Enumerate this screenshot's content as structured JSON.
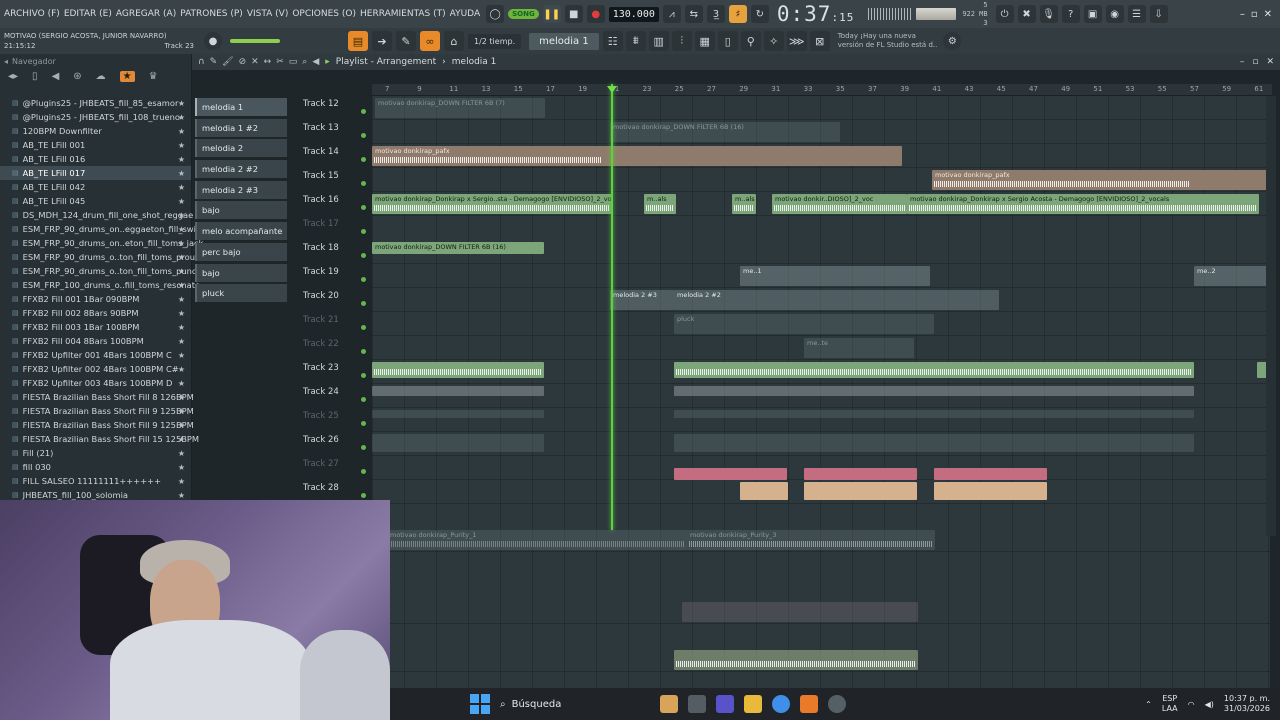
{
  "menu": [
    "ARCHIVO (F)",
    "EDITAR (E)",
    "AGREGAR (A)",
    "PATRONES (P)",
    "VISTA (V)",
    "OPCIONES (O)",
    "HERRAMIENTAS (T)",
    "AYUDA"
  ],
  "transport": {
    "song_label": "SONG",
    "tempo": "130.000",
    "time": "0:37",
    "time_sub": ":15",
    "time_mode": "M:S:CS",
    "cpu": "5",
    "mem": "922 MB",
    "voices": "3"
  },
  "project": {
    "title": "MOTIVAO (SERGIO ACOSTA, JUNIOR NAVARRO)",
    "clock": "21:15:12",
    "track": "Track 23"
  },
  "toolbar2": {
    "snap": "1/2 tiemp.",
    "pattern": "melodia 1",
    "news_line1": "Today  ¡Hay una nueva",
    "news_line2": "versión de FL Studio está d.."
  },
  "browser": {
    "title": "Navegador",
    "items": [
      "@Plugins25 - JHBEATS_fill_85_esamor",
      "@Plugins25 - JHBEATS_fill_108_trueno",
      "120BPM Downfilter",
      "AB_TE LFill 001",
      "AB_TE LFill 016",
      "AB_TE LFill 017",
      "AB_TE LFill 042",
      "AB_TE LFill 045",
      "DS_MDH_124_drum_fill_one_shot_reggae",
      "ESM_FRP_90_drums_on..eggaeton_fill_swing",
      "ESM_FRP_90_drums_on..eton_fill_toms_jack",
      "ESM_FRP_90_drums_o..ton_fill_toms_proud",
      "ESM_FRP_90_drums_o..ton_fill_toms_punch",
      "ESM_FRP_100_drums_o..fill_toms_resonate",
      "FFXB2 Fill 001 1Bar 090BPM",
      "FFXB2 Fill 002 8Bars 90BPM",
      "FFXB2 Fill 003 1Bar 100BPM",
      "FFXB2 Fill 004 8Bars 100BPM",
      "FFXB2 Upfilter 001 4Bars 100BPM C",
      "FFXB2 Upfilter 002 4Bars 100BPM C#",
      "FFXB2 Upfilter 003 4Bars 100BPM D",
      "FIESTA Brazilian Bass Short Fill 8 126BPM",
      "FIESTA Brazilian Bass Short Fill 9 125BPM",
      "FIESTA Brazilian Bass Short Fill 9 125BPM",
      "FIESTA Brazilian Bass Short Fill 15 125BPM",
      "Fill  (21)",
      "fill 030",
      "FILL SALSEO 11111111++++++",
      "JHBEATS_fill_100_solomia"
    ]
  },
  "picker": [
    "melodia 1",
    "melodia 1 #2",
    "melodia 2",
    "melodia 2 #2",
    "melodia 2 #3",
    "bajo",
    "melo acompañante",
    "perc bajo",
    "bajo",
    "pluck"
  ],
  "playlist": {
    "title": "Playlist - Arrangement",
    "crumb": "melodia 1",
    "ruler": [
      "7",
      "9",
      "11",
      "13",
      "15",
      "17",
      "19",
      "21",
      "23",
      "25",
      "27",
      "29",
      "31",
      "33",
      "35",
      "37",
      "39",
      "41",
      "43",
      "45",
      "47",
      "49",
      "51",
      "53",
      "55",
      "57",
      "59",
      "61"
    ],
    "tracks": [
      "Track 12",
      "Track 13",
      "Track 14",
      "Track 15",
      "Track 16",
      "Track 17",
      "Track 18",
      "Track 19",
      "Track 20",
      "Track 21",
      "Track 22",
      "Track 23",
      "Track 24",
      "Track 25",
      "Track 26",
      "Track 27",
      "Track 28"
    ]
  },
  "clips": {
    "t12": "motivao donkirap_DOWN FILTER 6B (7)",
    "t13": "motivao donkirap_DOWN FILTER 6B (16)",
    "t14": "motivao donkirap_pafx",
    "t15": "motivao donkirap_pafx",
    "t16a": "motivao donkirap_Donkirap x Sergio..sta - Demagogo [ENVIDIOSO]_2_vocals",
    "t16b": "m..als",
    "t16c": "m..als",
    "t16d": "motivao donkir..DIOSO]_2_voc",
    "t16e": "motivao donkirap_Donkirap x Sergio Acosta - Demagogo [ENVIDIOSO]_2_vocals",
    "t18": "motivao donkirap_DOWN FILTER 6B (16)",
    "t19": "me..1",
    "t19b": "me..2",
    "t20": "melodia 2 #3",
    "t20b": "melodia 2 #2",
    "t21": "pluck",
    "t22": "me..te",
    "purity1": "motivao donkirap_Purity_1",
    "purity3": "motivao donkirap_Purity_3"
  },
  "taskbar": {
    "search": "Búsqueda",
    "lang1": "ESP",
    "lang2": "LAA",
    "time": "10:37 p. m.",
    "date": "31/03/2026"
  }
}
